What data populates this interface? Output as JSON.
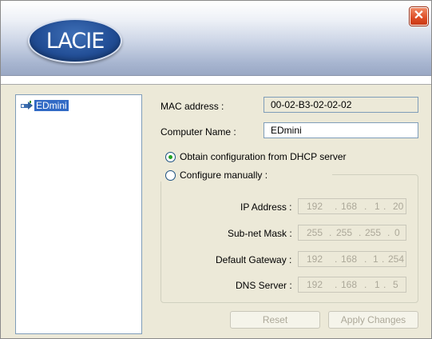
{
  "window": {
    "logo_text": "LACIE",
    "close_label": "✕"
  },
  "tree": {
    "items": [
      {
        "label": "EDmini",
        "icon": "network-icon"
      }
    ]
  },
  "form": {
    "mac_label": "MAC address :",
    "mac_value": "00-02-B3-02-02-02",
    "computer_name_label": "Computer Name :",
    "computer_name_value": "EDmini",
    "dhcp_label": "Obtain configuration from DHCP server",
    "dhcp_selected": true,
    "manual_label": "Configure manually :",
    "manual_selected": false,
    "ip_label": "IP Address :",
    "ip": [
      "192",
      "168",
      "1",
      "20"
    ],
    "mask_label": "Sub-net Mask :",
    "mask": [
      "255",
      "255",
      "255",
      "0"
    ],
    "gateway_label": "Default Gateway :",
    "gateway": [
      "192",
      "168",
      "1",
      "254"
    ],
    "dns_label": "DNS Server :",
    "dns": [
      "192",
      "168",
      "1",
      "5"
    ]
  },
  "buttons": {
    "reset": "Reset",
    "apply": "Apply Changes"
  }
}
